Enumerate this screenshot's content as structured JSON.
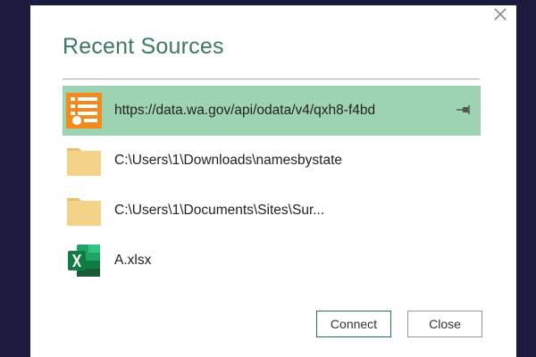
{
  "dialog": {
    "title": "Recent Sources",
    "close_icon": "close-x-icon"
  },
  "sources": [
    {
      "label": "https://data.wa.gov/api/odata/v4/qxh8-f4bd",
      "icon": "odata-feed-icon",
      "selected": true,
      "pinned": true
    },
    {
      "label": "C:\\Users\\1\\Downloads\\namesbystate",
      "icon": "folder-icon",
      "selected": false,
      "pinned": false
    },
    {
      "label": "C:\\Users\\1\\Documents\\Sites\\Sur...",
      "icon": "folder-icon",
      "selected": false,
      "pinned": false
    },
    {
      "label": "A.xlsx",
      "icon": "excel-icon",
      "selected": false,
      "pinned": false
    }
  ],
  "buttons": {
    "connect_label": "Connect",
    "close_label": "Close"
  },
  "colors": {
    "background": "#1c1a3f",
    "title": "#3c7b5c",
    "selected_row": "#9ed3b2",
    "odata_orange": "#f28a1e",
    "folder": "#f5d28a",
    "excel_green": "#1d6f42"
  }
}
